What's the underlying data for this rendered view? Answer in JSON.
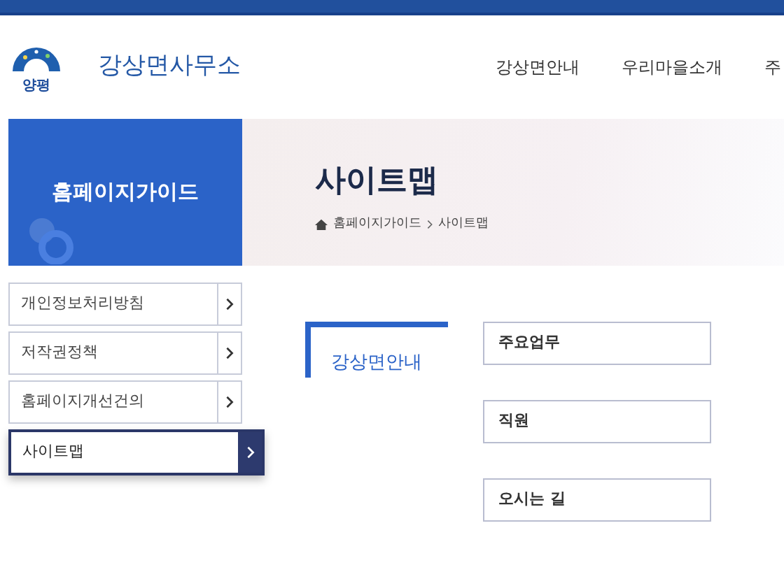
{
  "header": {
    "logo_text": "양평",
    "site_title": "강상면사무소",
    "nav": [
      {
        "label": "강상면안내"
      },
      {
        "label": "우리마을소개"
      },
      {
        "label": "주"
      }
    ]
  },
  "sidebar": {
    "title": "홈페이지가이드",
    "items": [
      {
        "label": "개인정보처리방침",
        "selected": false
      },
      {
        "label": "저작권정책",
        "selected": false
      },
      {
        "label": "홈페이지개선건의",
        "selected": false
      },
      {
        "label": "사이트맵",
        "selected": true
      }
    ]
  },
  "page": {
    "title": "사이트맵",
    "breadcrumb": [
      "홈페이지가이드",
      "사이트맵"
    ]
  },
  "sitemap": [
    {
      "section": "강상면안내",
      "links": [
        "주요업무",
        "직원",
        "오시는 길"
      ]
    }
  ]
}
